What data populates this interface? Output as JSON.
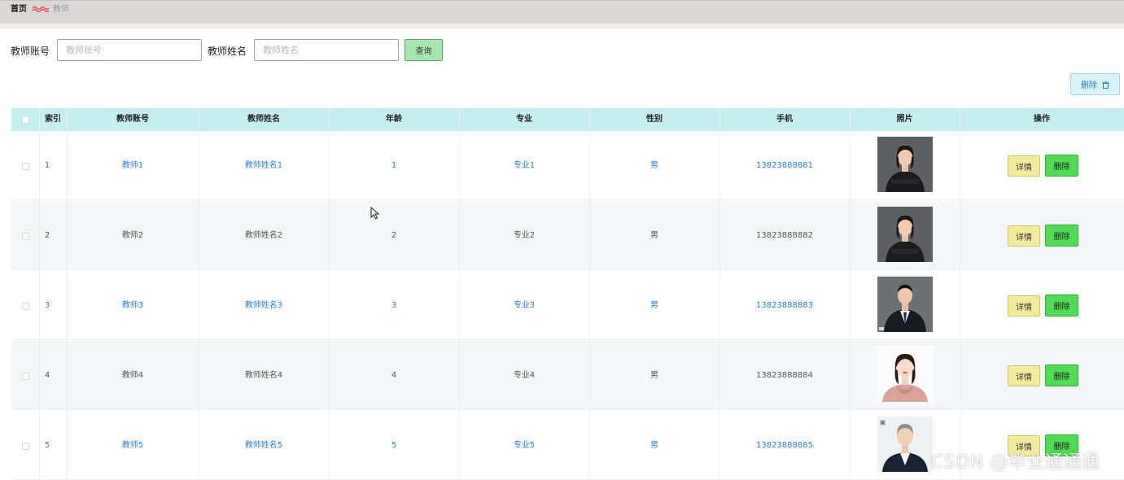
{
  "breadcrumb": {
    "home": "首页",
    "current": "教师"
  },
  "search": {
    "account_label": "教师账号",
    "account_placeholder": "教师账号",
    "account_value": "",
    "name_label": "教师姓名",
    "name_placeholder": "教师姓名",
    "name_value": "",
    "query_button": "查询"
  },
  "toolbar": {
    "delete_label": "删除",
    "delete_icon": "trash-icon"
  },
  "table": {
    "columns": [
      "索引",
      "教师账号",
      "教师姓名",
      "年龄",
      "专业",
      "性别",
      "手机",
      "照片",
      "操作"
    ],
    "rows": [
      {
        "index": "1",
        "account": "教师1",
        "name": "教师姓名1",
        "age": "1",
        "major": "专业1",
        "gender": "男",
        "phone": "13823888881",
        "photo": "woman-in-black-blazer",
        "detail": "详情",
        "delete": "删除"
      },
      {
        "index": "2",
        "account": "教师2",
        "name": "教师姓名2",
        "age": "2",
        "major": "专业2",
        "gender": "男",
        "phone": "13823888882",
        "photo": "woman-in-black-blazer",
        "detail": "详情",
        "delete": "删除"
      },
      {
        "index": "3",
        "account": "教师3",
        "name": "教师姓名3",
        "age": "3",
        "major": "专业3",
        "gender": "男",
        "phone": "13823888883",
        "photo": "man-in-dark-suit",
        "detail": "详情",
        "delete": "删除"
      },
      {
        "index": "4",
        "account": "教师4",
        "name": "教师姓名4",
        "age": "4",
        "major": "专业4",
        "gender": "男",
        "phone": "13823888884",
        "photo": "woman-in-pink-blouse",
        "detail": "详情",
        "delete": "删除"
      },
      {
        "index": "5",
        "account": "教师5",
        "name": "教师姓名5",
        "age": "5",
        "major": "专业5",
        "gender": "男",
        "phone": "13823888885",
        "photo": "man-in-navy-suit",
        "detail": "详情",
        "delete": "删除"
      }
    ]
  },
  "watermark": "CSDN @毕业通通通",
  "colors": {
    "header_bg": "#c4eeef",
    "link_blue": "#2b7fd0",
    "query_button": "#a7e5b2",
    "detail_button": "#f3eb9c",
    "delete_button": "#4fdb55",
    "batch_delete_button": "#d8f3fa"
  }
}
